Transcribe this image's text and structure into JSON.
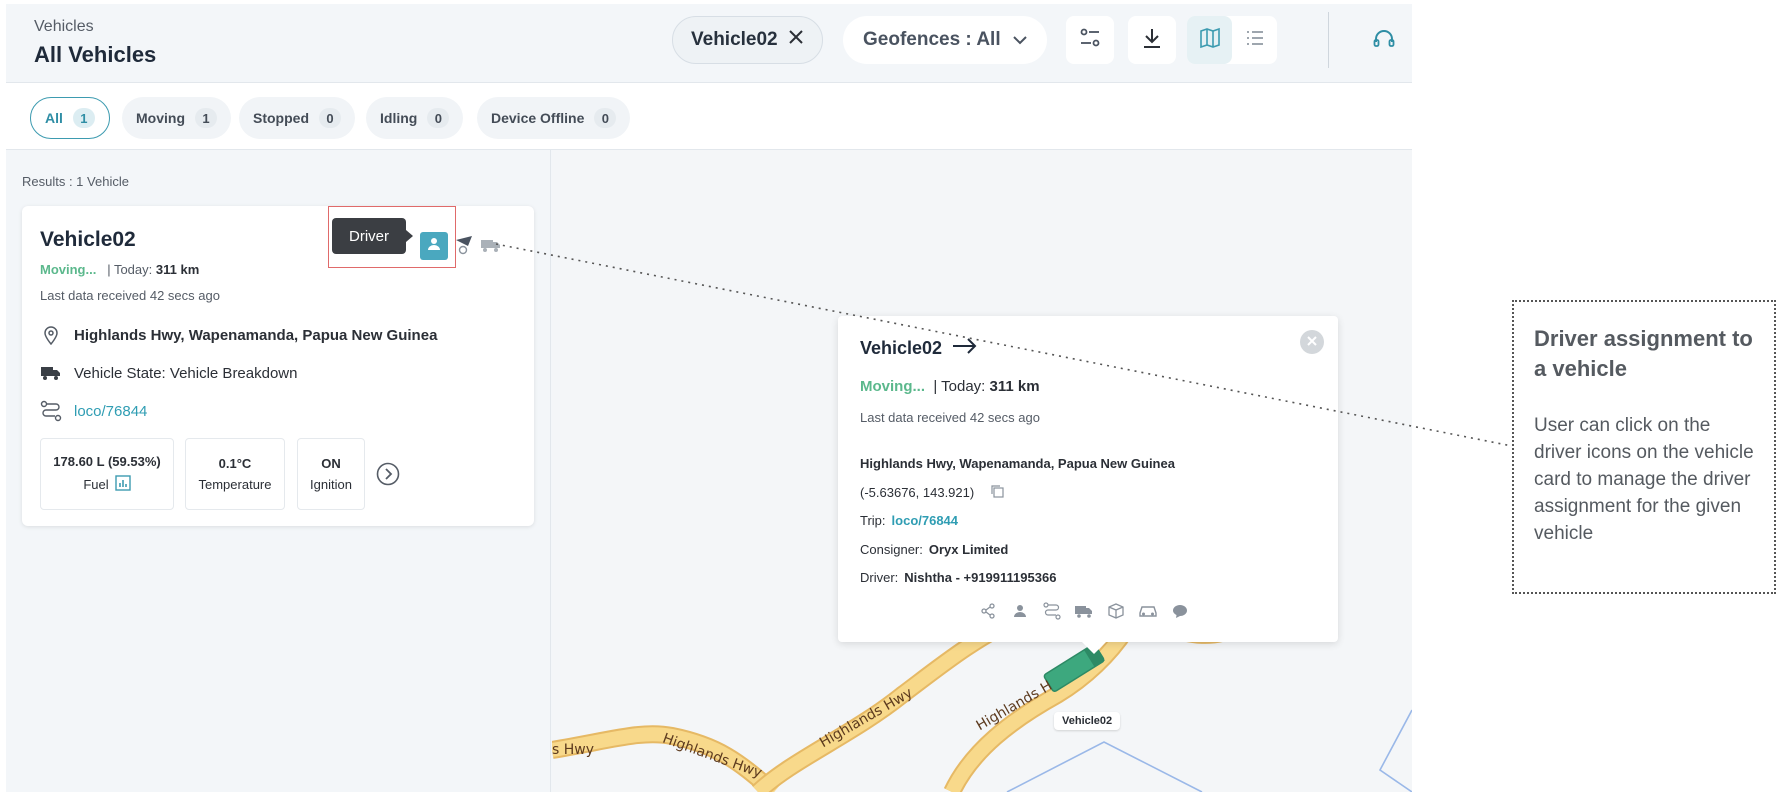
{
  "header": {
    "breadcrumb": "Vehicles",
    "title": "All Vehicles",
    "vehicle_chip": "Vehicle02",
    "geofence_label": "Geofences : All"
  },
  "filters": [
    {
      "label": "All",
      "count": "1",
      "active": true
    },
    {
      "label": "Moving",
      "count": "1"
    },
    {
      "label": "Stopped",
      "count": "0"
    },
    {
      "label": "Idling",
      "count": "0"
    },
    {
      "label": "Device Offline",
      "count": "0"
    }
  ],
  "results": "Results : 1 Vehicle",
  "card": {
    "name": "Vehicle02",
    "status": "Moving...",
    "today_prefix": "| Today:",
    "today_km": "311 km",
    "last_data": "Last data received 42 secs ago",
    "address": "Highlands Hwy, Wapenamanda, Papua New Guinea",
    "vehicle_state": "Vehicle State: Vehicle Breakdown",
    "trip": "loco/76844",
    "tooltip": "Driver",
    "stats": [
      {
        "value": "178.60 L (59.53%)",
        "label": "Fuel"
      },
      {
        "value": "0.1°C",
        "label": "Temperature"
      },
      {
        "value": "ON",
        "label": "Ignition"
      }
    ]
  },
  "popup": {
    "name": "Vehicle02",
    "status": "Moving...",
    "today_prefix": "| Today:",
    "today_km": "311 km",
    "last_data": "Last data received 42 secs ago",
    "address": "Highlands Hwy, Wapenamanda, Papua New Guinea",
    "coords": "(-5.63676, 143.921)",
    "trip_label": "Trip:",
    "trip": "loco/76844",
    "consigner_label": "Consigner:",
    "consigner": "Oryx Limited",
    "driver_label": "Driver:",
    "driver": "Nishtha - +919911195366"
  },
  "map": {
    "vehicle_label": "Vehicle02",
    "road_labels": [
      "s Hwy",
      "Highlands Hwy",
      "Highlands Hwy",
      "Highlands H"
    ]
  },
  "annotation": {
    "title": "Driver assignment to a vehicle",
    "body": "User can click on the driver icons on the vehicle card to manage the driver assignment for the given vehicle"
  },
  "colors": {
    "accent": "#3d9bb0",
    "moving": "#5bb88c",
    "highlight": "#e06a6a",
    "road": "#f8d98b"
  }
}
